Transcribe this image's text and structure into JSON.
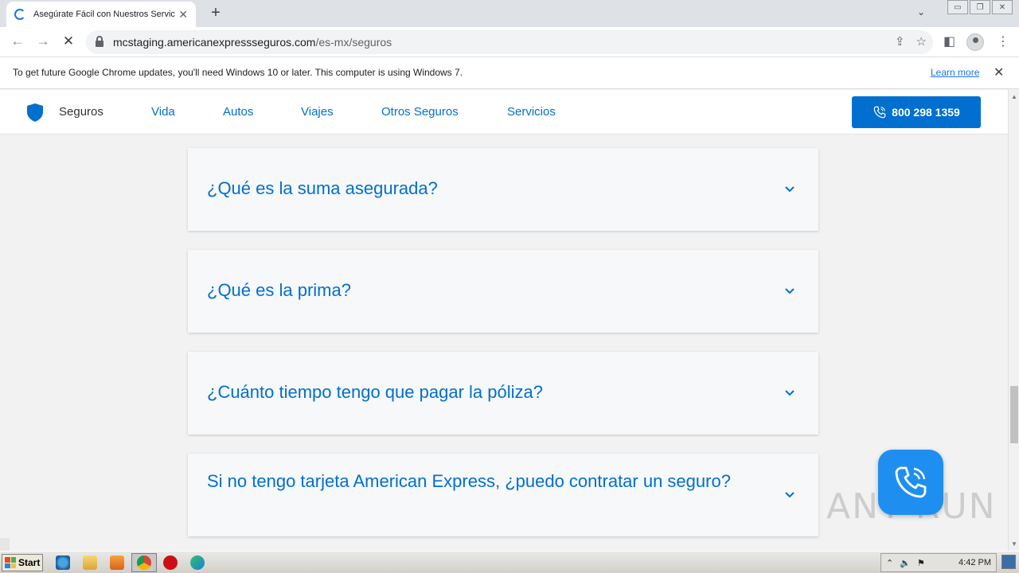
{
  "browser": {
    "tab_title": "Asegúrate Fácil con Nuestros Servicios",
    "tab_close": "✕",
    "new_tab": "+",
    "tab_search": "⌄",
    "window_controls": [
      "▭",
      "❐",
      "✕"
    ],
    "url_host": "mcstaging.americanexpressseguros.com",
    "url_path": "/es-mx/seguros",
    "nav_back": "←",
    "nav_forward": "→",
    "nav_stop": "✕",
    "share_icon": "⇪",
    "star_icon": "☆",
    "sidepanel_icon": "◧",
    "menu_icon": "⋮",
    "infobar_message": "To get future Google Chrome updates, you'll need Windows 10 or later. This computer is using Windows 7.",
    "infobar_link": "Learn more",
    "infobar_close": "✕"
  },
  "site": {
    "brand": "Seguros",
    "nav": [
      "Vida",
      "Autos",
      "Viajes",
      "Otros Seguros",
      "Servicios"
    ],
    "phone": "800 298 1359",
    "brand_color": "#006fcf",
    "faq": [
      "¿Qué es la suma asegurada?",
      "¿Qué es la prima?",
      "¿Cuánto tiempo tengo que pagar la póliza?",
      "Si no tengo tarjeta American Express, ¿puedo contratar un seguro?"
    ]
  },
  "watermark": "ANY RUN",
  "taskbar": {
    "start_label": "Start",
    "clock": "4:42 PM",
    "tray_icons": [
      "⌃",
      "🔈",
      "⚑"
    ]
  }
}
